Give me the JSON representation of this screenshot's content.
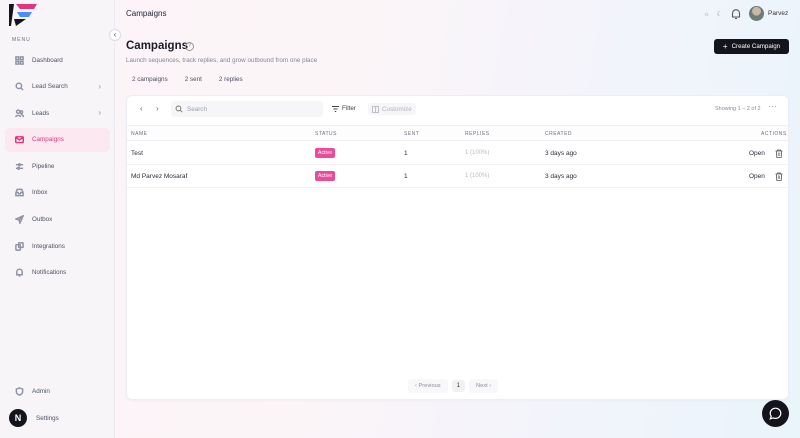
{
  "sidebar": {
    "menu_label": "MENU",
    "items": [
      {
        "label": "Dashboard",
        "icon": "grid-icon",
        "active": false,
        "has_chevron": false
      },
      {
        "label": "Lead Search",
        "icon": "search-icon",
        "active": false,
        "has_chevron": true
      },
      {
        "label": "Leads",
        "icon": "users-icon",
        "active": false,
        "has_chevron": true
      },
      {
        "label": "Campaigns",
        "icon": "mail-icon",
        "active": true,
        "has_chevron": false
      },
      {
        "label": "Pipeline",
        "icon": "pipeline-icon",
        "active": false,
        "has_chevron": false
      },
      {
        "label": "Inbox",
        "icon": "inbox-icon",
        "active": false,
        "has_chevron": false
      },
      {
        "label": "Outbox",
        "icon": "send-icon",
        "active": false,
        "has_chevron": false
      },
      {
        "label": "Integrations",
        "icon": "puzzle-icon",
        "active": false,
        "has_chevron": false
      },
      {
        "label": "Notifications",
        "icon": "bell-icon",
        "active": false,
        "has_chevron": false
      }
    ],
    "admin_label": "Admin",
    "settings_label": "Settings",
    "settings_avatar_letter": "N"
  },
  "topbar": {
    "title": "Campaigns",
    "user_name": "Parvez"
  },
  "page": {
    "title": "Campaigns",
    "subtitle": "Launch sequences, track replies, and grow outbound from one place",
    "create_button": "Create Campaign",
    "stats": [
      "2 campaigns",
      "2 sent",
      "2 replies"
    ]
  },
  "table": {
    "search_placeholder": "Search",
    "filter_label": "Filter",
    "customize_label": "Customize",
    "showing_text": "Showing 1 – 2 of 2",
    "columns": {
      "name": "NAME",
      "status": "STATUS",
      "sent": "SENT",
      "replies": "REPLIES",
      "created": "CREATED",
      "actions": "ACTIONS"
    },
    "rows": [
      {
        "name": "Test",
        "status": "Active",
        "sent": "1",
        "replies": "1 (100%)",
        "created": "3 days ago",
        "action": "Open"
      },
      {
        "name": "Md Parvez Mosaraf",
        "status": "Active",
        "sent": "1",
        "replies": "1 (100%)",
        "created": "3 days ago",
        "action": "Open"
      }
    ],
    "pagination": {
      "prev": "Previous",
      "page": "1",
      "next": "Next"
    }
  },
  "colors": {
    "accent": "#e1357d",
    "badge": "#ea4c9a",
    "primary_button": "#14151c"
  }
}
